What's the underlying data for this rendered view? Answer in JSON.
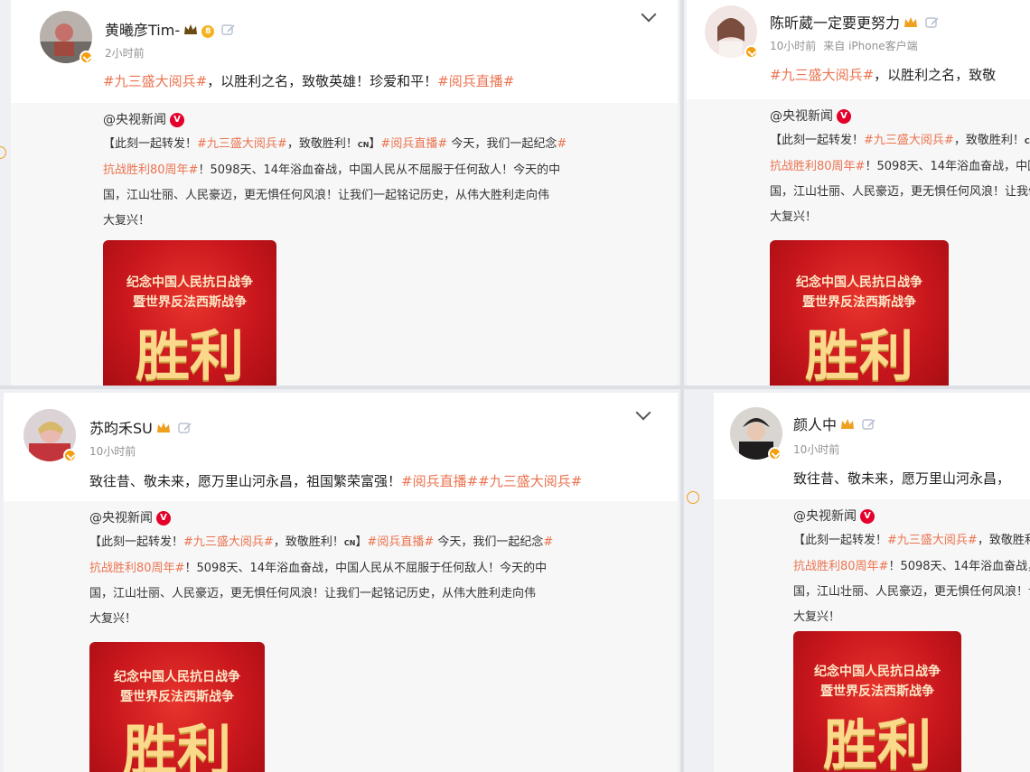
{
  "posts": [
    {
      "username": "黄曦彦Tim-",
      "time": "2小时前",
      "source": "",
      "svip_label": "8",
      "text_parts": [
        {
          "t": "#九三盛大阅兵#",
          "tag": true
        },
        {
          "t": "，以胜利之名，致敬英雄！珍爱和平！",
          "tag": false
        },
        {
          "t": "#阅兵直播#",
          "tag": true
        }
      ]
    },
    {
      "username": "陈昕葳一定要更努力",
      "time": "10小时前",
      "source": "来自 iPhone客户端",
      "text_parts": [
        {
          "t": "#九三盛大阅兵#",
          "tag": true
        },
        {
          "t": "，以胜利之名，致敬",
          "tag": false
        }
      ]
    },
    {
      "username": "苏昀禾SU",
      "time": "10小时前",
      "source": "",
      "text_parts": [
        {
          "t": "致往昔、敬未来，愿万里山河永昌，祖国繁荣富强！",
          "tag": false
        },
        {
          "t": "#阅兵直播##九三盛大阅兵#",
          "tag": true
        }
      ]
    },
    {
      "username": "颜人中",
      "time": "10小时前",
      "source": "",
      "text_parts": [
        {
          "t": "致往昔、敬未来，愿万里山河永昌，",
          "tag": false
        }
      ]
    }
  ],
  "repost": {
    "author": "@央视新闻",
    "v_label": "V",
    "lines": [
      [
        {
          "t": "【此刻一起转发！",
          "tag": false
        },
        {
          "t": "#九三盛大阅兵#",
          "tag": true
        },
        {
          "t": "，致敬胜利！",
          "tag": false
        },
        {
          "t": "CN",
          "tag": false,
          "small": true
        },
        {
          "t": "】",
          "tag": false
        },
        {
          "t": "#阅兵直播#",
          "tag": true
        },
        {
          "t": " 今天，我们一起纪念",
          "tag": false
        },
        {
          "t": "#",
          "tag": true
        }
      ],
      [
        {
          "t": "抗战胜利80周年#",
          "tag": true
        },
        {
          "t": "！5098天、14年浴血奋战，中国人民从不屈服于任何敌人！今天的中",
          "tag": false
        }
      ],
      [
        {
          "t": "国，江山壮丽、人民豪迈，更无惧任何风浪！让我们一起铭记历史，从伟大胜利走向伟",
          "tag": false
        }
      ],
      [
        {
          "t": "大复兴！",
          "tag": false
        }
      ]
    ]
  },
  "poster": {
    "line1": "纪念中国人民抗日战争",
    "line2": "暨世界反法西斯战争",
    "big": "胜利"
  },
  "colors": {
    "hashtag": "#eb7350",
    "poster_red": "#c8161d",
    "poster_gold": "#fbd98b",
    "verified": "#f59e0b"
  }
}
